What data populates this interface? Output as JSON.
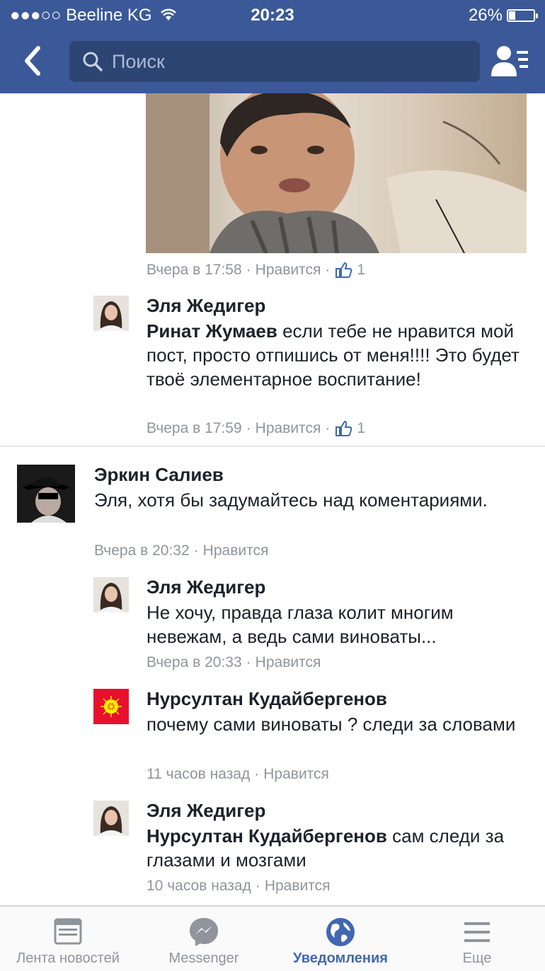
{
  "status_bar": {
    "carrier": "●●●○○ Beeline KG",
    "time": "20:23",
    "battery": "26%",
    "battery_level": 0.26
  },
  "search": {
    "placeholder": "Поиск"
  },
  "comments": [
    {
      "meta": {
        "time": "Вчера в 17:58",
        "like": "Нравится",
        "count": "1"
      }
    },
    {
      "author": "Эля Жедигер",
      "mention": "Ринат Жумаев",
      "text": " если тебе не нравится мой пост, просто отпишись от меня!!!! Это будет твоё элементарное воспитание!",
      "meta": {
        "time": "Вчера в 17:59",
        "like": "Нравится",
        "count": "1"
      }
    },
    {
      "author": "Эркин Салиев",
      "text": "Эля, хотя бы задумайтесь над коментариями.",
      "meta": {
        "time": "Вчера в 20:32",
        "like": "Нравится"
      }
    },
    {
      "author": "Эля Жедигер",
      "text": "Не хочу, правда глаза колит многим невежам, а ведь сами виноваты...",
      "meta": {
        "time": "Вчера в 20:33",
        "like": "Нравится"
      }
    },
    {
      "author": "Нурсултан Кудайбергенов",
      "text": "почему сами виноваты ? следи за словами",
      "meta": {
        "time": "11 часов назад",
        "like": "Нравится"
      }
    },
    {
      "author": "Эля Жедигер",
      "mention": "Нурсултан Кудайбергенов",
      "text": " сам следи за глазами и мозгами",
      "meta": {
        "time": "10 часов назад",
        "like": "Нравится"
      }
    }
  ],
  "tabs": [
    {
      "label": "Лента новостей"
    },
    {
      "label": "Messenger"
    },
    {
      "label": "Уведомления"
    },
    {
      "label": "Еще"
    }
  ],
  "colors": {
    "brand": "#3b5998",
    "accent": "#4267b2",
    "meta_gray": "#90949c"
  }
}
